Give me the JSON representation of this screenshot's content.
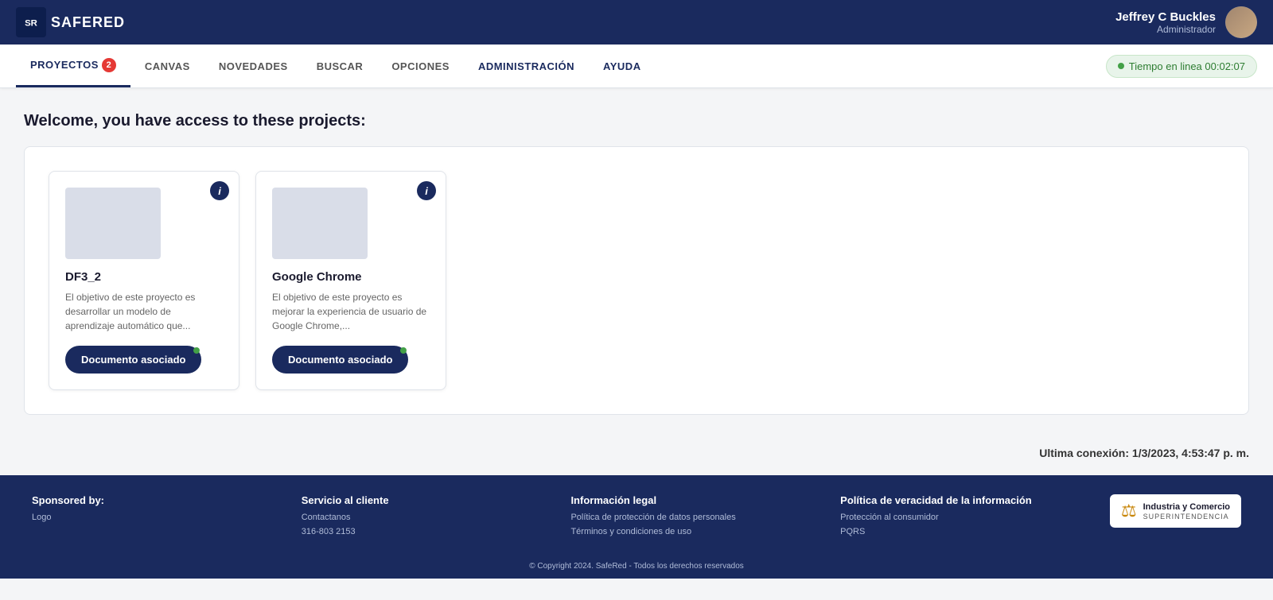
{
  "header": {
    "logo_text": "SAFERED",
    "user_name": "Jeffrey C Buckles",
    "user_role": "Administrador"
  },
  "nav": {
    "items": [
      {
        "id": "proyectos",
        "label": "PROYECTOS",
        "active": true,
        "badge": 2
      },
      {
        "id": "canvas",
        "label": "CANVAS",
        "active": false,
        "badge": null
      },
      {
        "id": "novedades",
        "label": "NOVEDADES",
        "active": false,
        "badge": null
      },
      {
        "id": "buscar",
        "label": "BUSCAR",
        "active": false,
        "badge": null
      },
      {
        "id": "opciones",
        "label": "OPCIONES",
        "active": false,
        "badge": null
      },
      {
        "id": "administracion",
        "label": "ADMINISTRACIÓN",
        "active": false,
        "badge": null,
        "bold": true
      },
      {
        "id": "ayuda",
        "label": "AYUDA",
        "active": false,
        "badge": null
      }
    ],
    "timer_label": "Tiempo en linea 00:02:07"
  },
  "main": {
    "welcome_text": "Welcome, you have access to these projects:",
    "projects": [
      {
        "id": "df3_2",
        "title": "DF3_2",
        "description": "El objetivo de este proyecto es desarrollar un modelo de aprendizaje automático que...",
        "button_label": "Documento asociado"
      },
      {
        "id": "google_chrome",
        "title": "Google Chrome",
        "description": "El objetivo de este proyecto es mejorar la experiencia de usuario de Google Chrome,...",
        "button_label": "Documento asociado"
      }
    ],
    "last_connection_label": "Ultima conexión:",
    "last_connection_value": "1/3/2023, 4:53:47 p. m."
  },
  "footer": {
    "sponsored_title": "Sponsored by:",
    "sponsored_logo": "Logo",
    "servicio_title": "Servicio al cliente",
    "servicio_lines": [
      "Contactanos",
      "316-803 2153"
    ],
    "legal_title": "Información legal",
    "legal_lines": [
      "Política de protección de datos personales",
      "Términos y condiciones de uso"
    ],
    "politica_title": "Política de veracidad de la información",
    "politica_lines": [
      "Protección al consumidor",
      "PQRS"
    ],
    "brand_name": "Industria y Comercio",
    "brand_sub": "SUPERINTENDENCIA",
    "copyright": "© Copyright 2024. SafeRed - Todos los derechos reservados"
  }
}
